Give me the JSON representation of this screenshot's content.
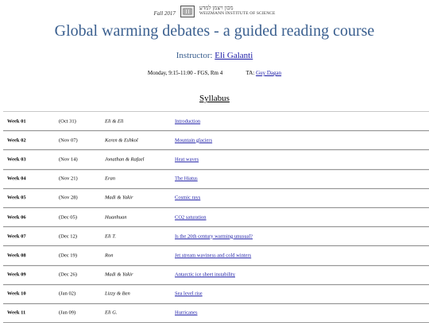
{
  "header": {
    "term": "Fall 2017",
    "logo_hebrew": "מכון ויצמן למדע",
    "logo_english": "WEIZMANN INSTITUTE OF SCIENCE"
  },
  "title": "Global warming debates - a guided reading course",
  "instructor": {
    "label": "Instructor:",
    "name": "Eli Galanti"
  },
  "meta": {
    "schedule": "Monday, 9:15-11:00 -  FGS, Rm 4",
    "ta_label": "TA:",
    "ta_name": "Guy Dagan"
  },
  "syllabus_heading": "Syllabus",
  "rows": [
    {
      "week": "Week  01",
      "date": "(Oct 31)",
      "presenter": "Eli & Eli",
      "topic": "Introduction"
    },
    {
      "week": "Week  02",
      "date": "(Nov 07)",
      "presenter": "Keren & Eshkol",
      "topic": "Mountain glaciers"
    },
    {
      "week": "Week  03",
      "date": "(Nov 14)",
      "presenter": "Jonathan & Rafael",
      "topic": "Heat waves"
    },
    {
      "week": "Week  04",
      "date": "(Nov 21)",
      "presenter": "Eran",
      "topic": "The Hiatus"
    },
    {
      "week": "Week  05",
      "date": "(Nov 28)",
      "presenter": "Madi & Yakir",
      "topic": "Cosmic rays"
    },
    {
      "week": "Week  06",
      "date": "(Dec 05)",
      "presenter": "Huanhuan",
      "topic": "CO2 saturation"
    },
    {
      "week": "Week  07",
      "date": "(Dec 12)",
      "presenter": "Eli T.",
      "topic": "Is the 20th century warming unusual?"
    },
    {
      "week": "Week  08",
      "date": "(Dec 19)",
      "presenter": "Ron",
      "topic": "Jet stream waviness and cold winters"
    },
    {
      "week": "Week  09",
      "date": "(Dec 26)",
      "presenter": "Madi & Yakir",
      "topic": "Antarctic ice sheet instability"
    },
    {
      "week": "Week  10",
      "date": "(Jan 02)",
      "presenter": "Lizzy & Ben",
      "topic": "Sea level rise"
    },
    {
      "week": "Week  11",
      "date": "(Jan 09)",
      "presenter": "Eli G.",
      "topic": "Hurricanes"
    }
  ]
}
